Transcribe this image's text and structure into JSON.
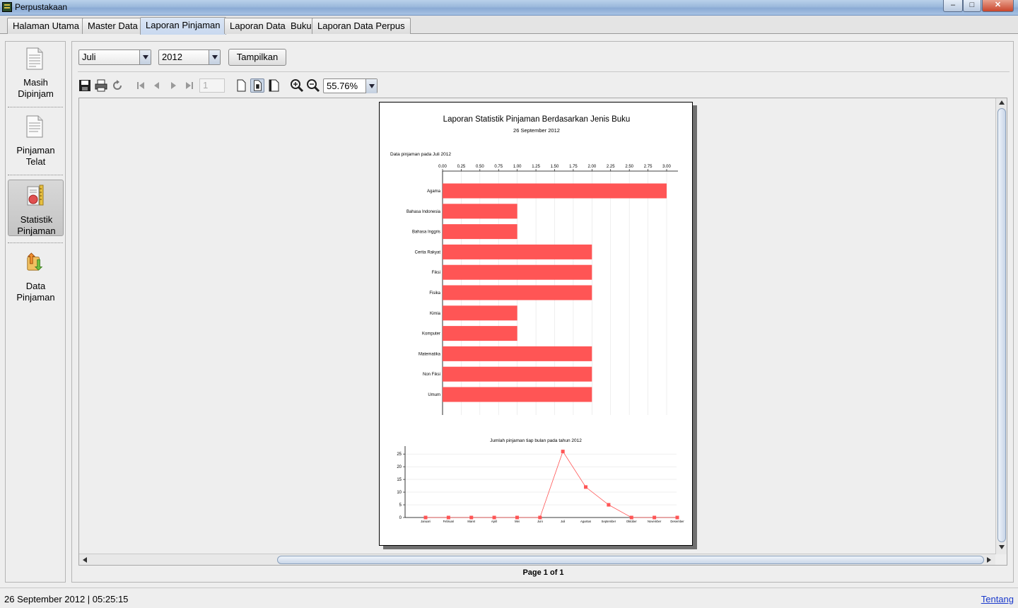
{
  "window": {
    "title": "Perpustakaan",
    "min": "–",
    "max": "□",
    "close": "✕"
  },
  "tabs": [
    "Halaman Utama",
    "Master Data",
    "Laporan Pinjaman",
    "Laporan Data  Buku",
    "Laporan Data Perpus"
  ],
  "active_tab": "Laporan Pinjaman",
  "sidebar": {
    "items": [
      {
        "label_line1": "Masih",
        "label_line2": "Dipinjam",
        "icon": "document-icon"
      },
      {
        "label_line1": "Pinjaman",
        "label_line2": "Telat",
        "icon": "document-late-icon"
      },
      {
        "label_line1": "Statistik",
        "label_line2": "Pinjaman",
        "icon": "statistics-icon"
      },
      {
        "label_line1": "Data",
        "label_line2": "Pinjaman",
        "icon": "data-transfer-icon"
      }
    ],
    "active": "Statistik Pinjaman"
  },
  "filter": {
    "month": "Juli",
    "year": "2012",
    "show_button": "Tampilkan"
  },
  "viewer_toolbar": {
    "page_number": "1",
    "zoom": "55.76%",
    "icons": [
      "save-icon",
      "print-icon",
      "reload-icon",
      "first-page-icon",
      "previous-page-icon",
      "next-page-icon",
      "last-page-icon",
      "actual-size-icon",
      "fit-page-icon",
      "fit-width-icon",
      "zoom-in-icon",
      "zoom-out-icon"
    ]
  },
  "report": {
    "title": "Laporan Statistik Pinjaman Berdasarkan Jenis Buku",
    "date": "26 September 2012",
    "bar_caption": "Data pinjaman pada Juli 2012",
    "line_title": "Jumlah pinjaman tiap bulan pada tahun 2012"
  },
  "chart_data": [
    {
      "type": "bar",
      "orientation": "horizontal",
      "title": "Data pinjaman pada Juli 2012",
      "categories": [
        "Agama",
        "Bahasa Indonesia",
        "Bahasa Inggris",
        "Cerita Rakyat",
        "Fiksi",
        "Fisika",
        "Kimia",
        "Komputer",
        "Matematika",
        "Non Fiksi",
        "Umum"
      ],
      "values": [
        3,
        1,
        1,
        2,
        2,
        2,
        1,
        1,
        2,
        2,
        2
      ],
      "xlim": [
        0,
        3.0
      ],
      "ticks": [
        "0.00",
        "0.25",
        "0.50",
        "0.75",
        "1.00",
        "1.25",
        "1.50",
        "1.75",
        "2.00",
        "2.25",
        "2.50",
        "2.75",
        "3.00"
      ],
      "tick_values": [
        0,
        0.25,
        0.5,
        0.75,
        1,
        1.25,
        1.5,
        1.75,
        2,
        2.25,
        2.5,
        2.75,
        3
      ],
      "color": "#ff5555",
      "axis_position": "top",
      "grid": true
    },
    {
      "type": "line",
      "title": "Jumlah pinjaman tiap bulan pada tahun 2012",
      "categories": [
        "Januari",
        "Februari",
        "Maret",
        "April",
        "Mei",
        "Juni",
        "Juli",
        "Agustus",
        "September",
        "Oktober",
        "November",
        "Desember"
      ],
      "values": [
        0,
        0,
        0,
        0,
        0,
        0,
        26,
        12,
        5,
        0,
        0,
        0
      ],
      "ylim": [
        0,
        27
      ],
      "yticks": [
        "0",
        "5",
        "10",
        "15",
        "20",
        "25"
      ],
      "ytick_values": [
        0,
        5,
        10,
        15,
        20,
        25
      ],
      "color": "#ff5555",
      "grid": true
    }
  ],
  "pager": {
    "status": "Page 1 of 1"
  },
  "status": {
    "datetime": "26 September 2012 | 05:25:15",
    "about_link": "Tentang"
  }
}
